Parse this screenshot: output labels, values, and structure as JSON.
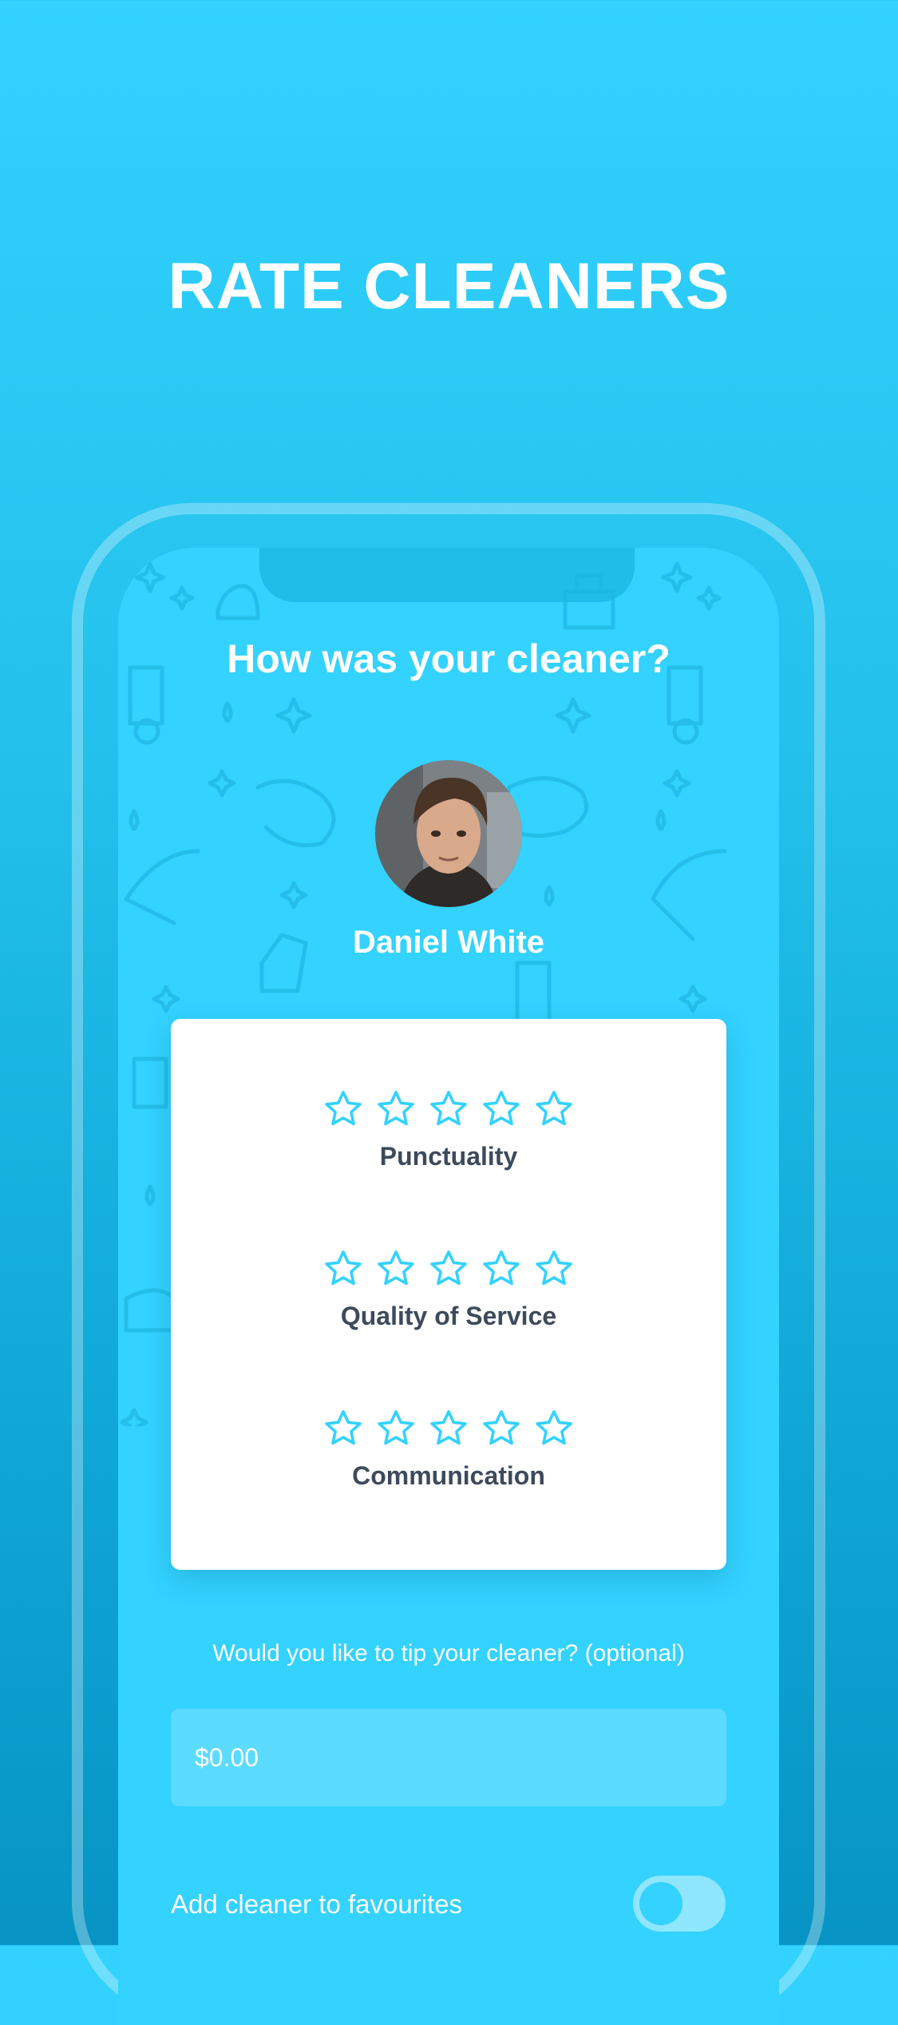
{
  "headline": "RATE CLEANERS",
  "screen": {
    "title": "How was your cleaner?",
    "cleaner": {
      "name": "Daniel White"
    },
    "ratings": [
      {
        "label": "Punctuality",
        "stars_max": 5,
        "stars_selected": 0
      },
      {
        "label": "Quality of Service",
        "stars_max": 5,
        "stars_selected": 0
      },
      {
        "label": "Communication",
        "stars_max": 5,
        "stars_selected": 0
      }
    ],
    "tip": {
      "question": "Would you like to tip your cleaner? (optional)",
      "placeholder": "$0.00"
    },
    "favourite": {
      "label": "Add cleaner to favourites",
      "enabled": false
    }
  },
  "colors": {
    "accent": "#33d2ff",
    "star_outline": "#33d2ff",
    "label_text": "#3d4a5c",
    "card": "#ffffff"
  },
  "icons": [
    "star-outline-icon",
    "toggle-switch"
  ]
}
